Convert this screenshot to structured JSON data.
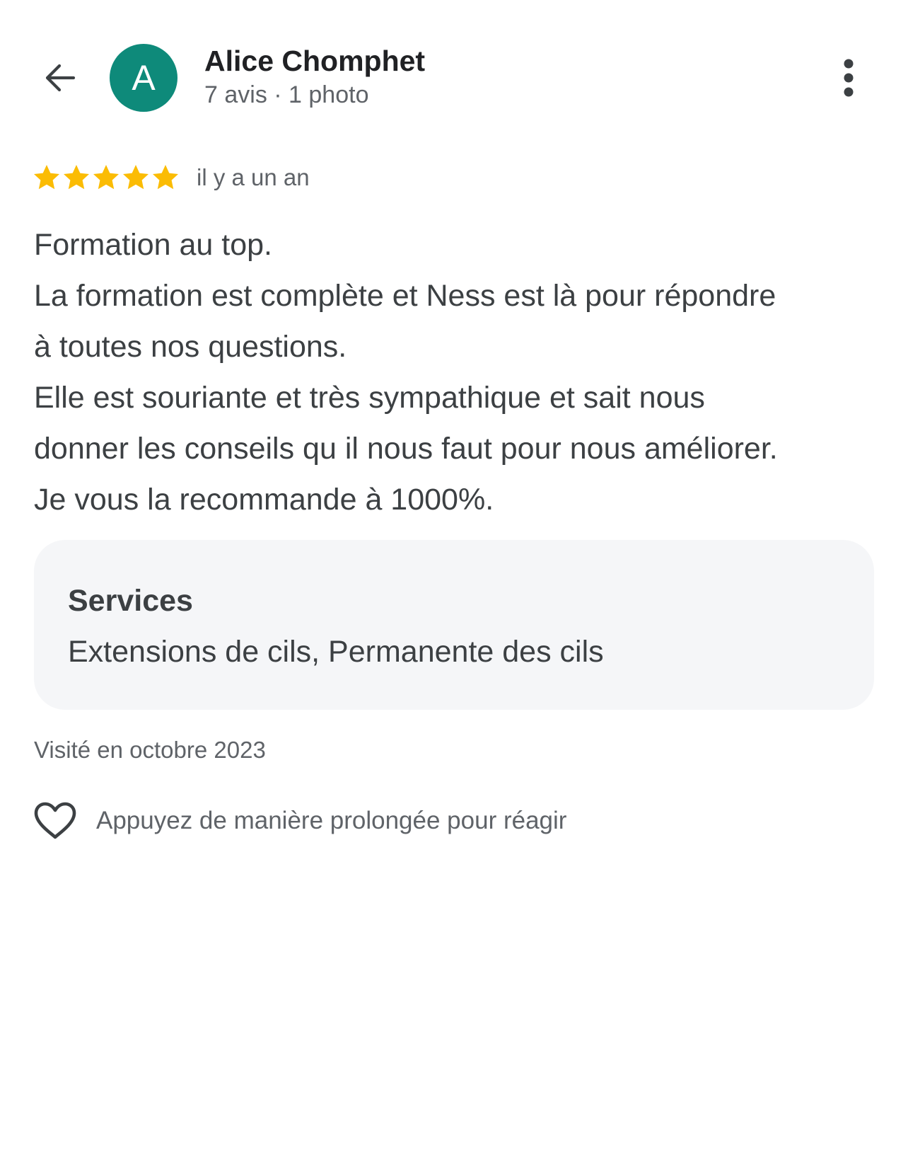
{
  "header": {
    "back_icon": "arrow-back-icon",
    "avatar": {
      "letter": "A",
      "color": "#0e8a7a"
    },
    "author_name": "Alice Chomphet",
    "author_meta": "7 avis · 1 photo",
    "more_icon": "more-vert-icon"
  },
  "review": {
    "rating": 5,
    "rating_max": 5,
    "star_color": "#fbbc04",
    "time_ago": "il y a un an",
    "text_lines": [
      "Formation au top.",
      "La formation est complète et Ness est là pour répondre",
      "à toutes nos questions.",
      "Elle est souriante et très sympathique et sait nous",
      "donner les conseils qu il nous faut pour nous améliorer.",
      "Je vous la recommande à 1000%."
    ]
  },
  "services": {
    "title": "Services",
    "value": "Extensions de cils, Permanente des cils"
  },
  "visited": "Visité en octobre 2023",
  "reaction": {
    "icon": "heart-outline-icon",
    "hint": "Appuyez de manière prolongée pour réagir"
  }
}
